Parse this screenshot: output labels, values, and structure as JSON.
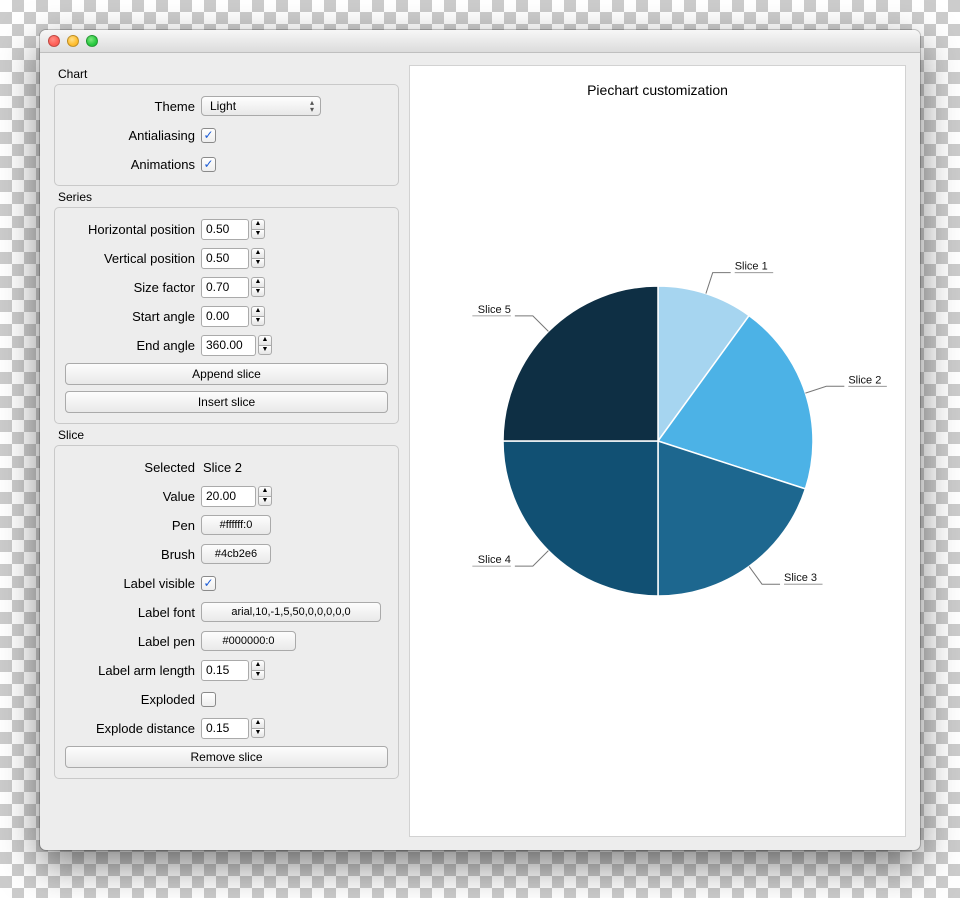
{
  "chart_data": {
    "type": "pie",
    "title": "Piechart customization",
    "series": [
      {
        "name": "Slice 1",
        "value": 10,
        "color": "#a6d5f0"
      },
      {
        "name": "Slice 2",
        "value": 20,
        "color": "#4cb2e6"
      },
      {
        "name": "Slice 3",
        "value": 20,
        "color": "#1d678f"
      },
      {
        "name": "Slice 4",
        "value": 25,
        "color": "#115073"
      },
      {
        "name": "Slice 5",
        "value": 25,
        "color": "#0e2f44"
      }
    ]
  },
  "chart_group": {
    "title": "Chart",
    "theme_label": "Theme",
    "theme_value": "Light",
    "antialiasing_label": "Antialiasing",
    "antialiasing_checked": true,
    "animations_label": "Animations",
    "animations_checked": true
  },
  "series_group": {
    "title": "Series",
    "hpos_label": "Horizontal position",
    "hpos_value": "0.50",
    "vpos_label": "Vertical position",
    "vpos_value": "0.50",
    "size_label": "Size factor",
    "size_value": "0.70",
    "start_label": "Start angle",
    "start_value": "0.00",
    "end_label": "End angle",
    "end_value": "360.00",
    "append_btn": "Append slice",
    "insert_btn": "Insert slice"
  },
  "slice_group": {
    "title": "Slice",
    "selected_label": "Selected",
    "selected_value": "Slice 2",
    "value_label": "Value",
    "value_value": "20.00",
    "pen_label": "Pen",
    "pen_value": "#ffffff:0",
    "brush_label": "Brush",
    "brush_value": "#4cb2e6",
    "labelvis_label": "Label visible",
    "labelvis_checked": true,
    "labelfont_label": "Label font",
    "labelfont_value": "arial,10,-1,5,50,0,0,0,0,0",
    "labelpen_label": "Label pen",
    "labelpen_value": "#000000:0",
    "labelarm_label": "Label arm length",
    "labelarm_value": "0.15",
    "exploded_label": "Exploded",
    "exploded_checked": false,
    "explodedist_label": "Explode distance",
    "explodedist_value": "0.15",
    "remove_btn": "Remove slice"
  }
}
